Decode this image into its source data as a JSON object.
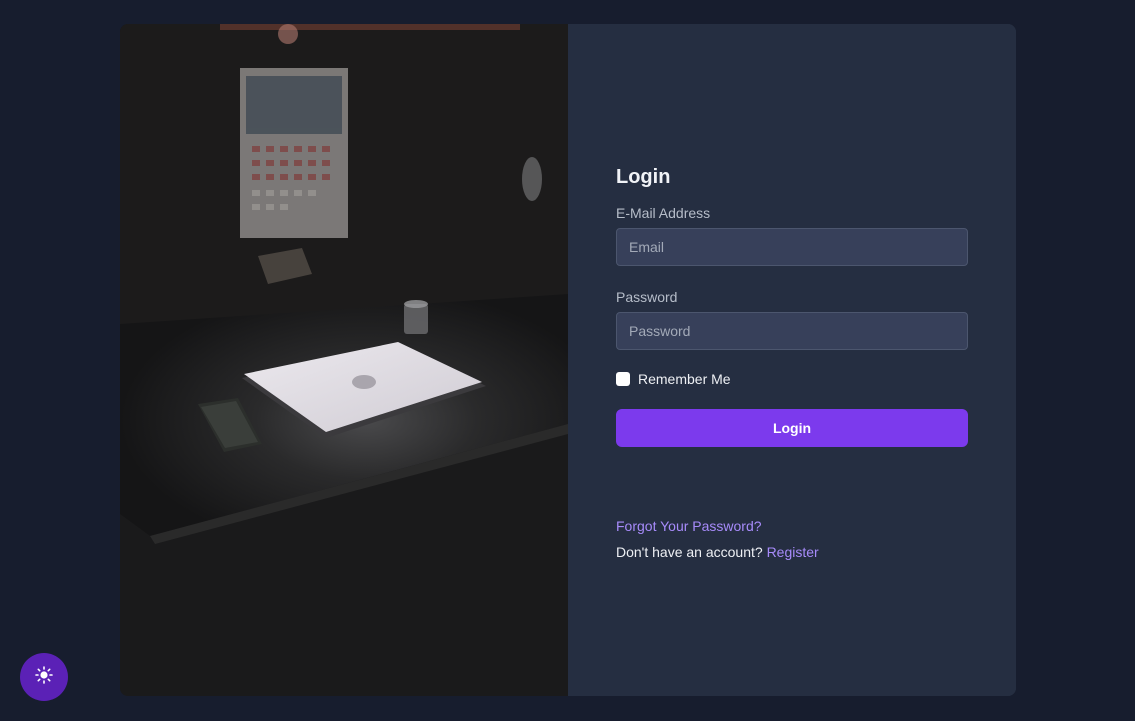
{
  "login": {
    "title": "Login",
    "email_label": "E-Mail Address",
    "email_placeholder": "Email",
    "email_value": "",
    "password_label": "Password",
    "password_placeholder": "Password",
    "password_value": "",
    "remember_label": "Remember Me",
    "remember_checked": false,
    "submit_label": "Login"
  },
  "links": {
    "forgot_password": "Forgot Your Password?",
    "no_account_text": "Don't have an account?",
    "register": "Register"
  },
  "theme_toggle": {
    "icon": "sun-icon"
  },
  "colors": {
    "page_background": "#171d2e",
    "panel_background": "#252e41",
    "input_background": "#37405a",
    "accent": "#7c3aed",
    "link": "#a78bfa",
    "toggle_background": "#5b21b6"
  }
}
